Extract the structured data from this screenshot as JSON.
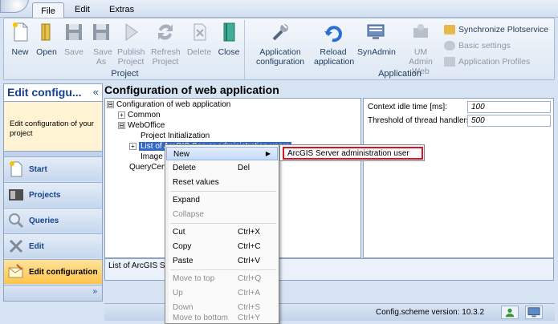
{
  "menu": {
    "file": "File",
    "edit": "Edit",
    "extras": "Extras"
  },
  "ribbon": {
    "project": {
      "label": "Project",
      "buttons": [
        {
          "label": "New",
          "icon": "new-document-icon"
        },
        {
          "label": "Open",
          "icon": "open-folder-icon"
        },
        {
          "label": "Save",
          "icon": "save-disk-icon"
        },
        {
          "label": "Save As",
          "icon": "save-as-icon"
        },
        {
          "label": "Publish Project",
          "icon": "publish-icon"
        },
        {
          "label": "Refresh Project",
          "icon": "refresh-icon"
        },
        {
          "label": "Delete",
          "icon": "delete-icon"
        },
        {
          "label": "Close",
          "icon": "close-book-icon"
        }
      ]
    },
    "application": {
      "label": "Application",
      "buttons": [
        {
          "label": "Application configuration",
          "icon": "wrench-config-icon"
        },
        {
          "label": "Reload application",
          "icon": "reload-icon"
        },
        {
          "label": "SynAdmin",
          "icon": "synadmin-icon"
        },
        {
          "label": "UM Admin Web",
          "icon": "user-admin-icon"
        }
      ],
      "small": [
        {
          "label": "Synchronize Plotservice",
          "icon": "sync-icon"
        },
        {
          "label": "Basic settings",
          "icon": "settings-icon"
        },
        {
          "label": "Application Profiles",
          "icon": "profiles-icon"
        }
      ]
    }
  },
  "nav": {
    "title": "Edit configu...",
    "collapse": "«",
    "description": "Edit configuration of your project",
    "items": [
      {
        "label": "Start",
        "icon": "start-icon"
      },
      {
        "label": "Projects",
        "icon": "projects-icon"
      },
      {
        "label": "Queries",
        "icon": "search-magnifier-icon"
      },
      {
        "label": "Edit",
        "icon": "tools-icon"
      },
      {
        "label": "Edit configuration",
        "icon": "envelope-edit-icon"
      }
    ],
    "more": "»"
  },
  "main": {
    "title": "Configuration of web application",
    "tree": [
      {
        "label": "Configuration of web application",
        "box": "⊟"
      },
      {
        "label": "Common",
        "box": "+"
      },
      {
        "label": "WebOffice",
        "box": "⊟"
      },
      {
        "label": "Project Initialization",
        "box": ""
      },
      {
        "label": "List of ArcGIS Server administration users",
        "box": "+"
      },
      {
        "label": "Image E",
        "box": ""
      },
      {
        "label": "QueryCente",
        "box": ""
      }
    ],
    "props": [
      {
        "label": "Context idle time [ms]:",
        "value": "100"
      },
      {
        "label": "Threshold of thread handlers:",
        "value": "500"
      }
    ],
    "description": "List of ArcGIS Serv"
  },
  "context_menu": {
    "items": [
      {
        "label": "New",
        "shortcut": "",
        "submenu": true
      },
      {
        "label": "Delete",
        "shortcut": "Del"
      },
      {
        "label": "Reset values",
        "shortcut": ""
      },
      {
        "label": "Expand",
        "shortcut": ""
      },
      {
        "label": "Collapse",
        "shortcut": "",
        "disabled": true
      },
      {
        "label": "Cut",
        "shortcut": "Ctrl+X"
      },
      {
        "label": "Copy",
        "shortcut": "Ctrl+C"
      },
      {
        "label": "Paste",
        "shortcut": "Ctrl+V"
      },
      {
        "label": "Move to top",
        "shortcut": "Ctrl+Q",
        "disabled": true
      },
      {
        "label": "Up",
        "shortcut": "Ctrl+A",
        "disabled": true
      },
      {
        "label": "Down",
        "shortcut": "Ctrl+S",
        "disabled": true
      },
      {
        "label": "Move to bottom",
        "shortcut": "Ctrl+Y",
        "disabled": true
      }
    ],
    "submenu_item": "ArcGIS Server administration user"
  },
  "status": {
    "version": "Config.scheme version:  10.3.2"
  }
}
